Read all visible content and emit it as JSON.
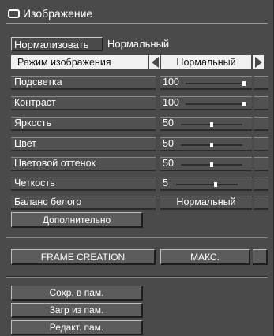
{
  "title": "Изображение",
  "normalize": {
    "button_label": "Нормализовать",
    "value": "Нормальный"
  },
  "mode": {
    "label": "Режим изображения",
    "value": "Нормальный"
  },
  "settings": [
    {
      "label": "Подсветка",
      "value": "100",
      "level": 1.0
    },
    {
      "label": "Контраст",
      "value": "100",
      "level": 1.0
    },
    {
      "label": "Яркость",
      "value": "50",
      "level": 0.5
    },
    {
      "label": "Цвет",
      "value": "50",
      "level": 0.5
    },
    {
      "label": "Цветовой оттенок",
      "value": "50",
      "level": 0.5
    },
    {
      "label": "Четкость",
      "value": "5",
      "level": 0.5
    }
  ],
  "white_balance": {
    "label": "Баланс белого",
    "value": "Нормальный"
  },
  "advanced_label": "Дополнительно",
  "frame_creation": {
    "label": "FRAME CREATION",
    "value": "МАКС."
  },
  "memory": {
    "save": "Сохр. в пам.",
    "load": "Загр из пам.",
    "edit": "Редакт. пам."
  }
}
